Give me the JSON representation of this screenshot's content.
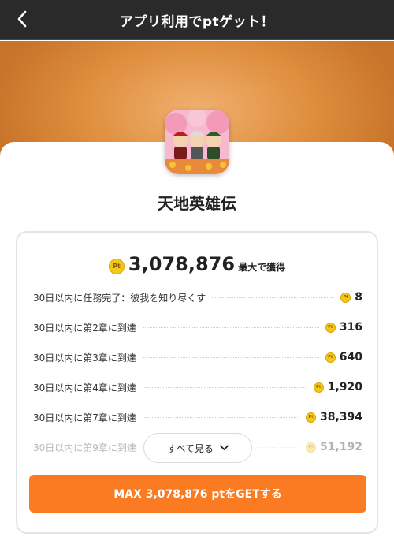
{
  "header": {
    "title": "アプリ利用でptゲット！",
    "back_icon": "chevron-left-icon"
  },
  "colors": {
    "header_bg": "#2a2a2a",
    "hero": "#df8f3e",
    "accent": "#fb7b23",
    "coin": "#f3c81c"
  },
  "app": {
    "name": "天地英雄伝"
  },
  "coin_label": "Pt",
  "summary": {
    "total": "3,078,876",
    "suffix": "最大で獲得"
  },
  "tasks": [
    {
      "label": "30日以内に任務完了：彼我を知り尽くす",
      "points": "8"
    },
    {
      "label": "30日以内に第2章に到達",
      "points": "316"
    },
    {
      "label": "30日以内に第3章に到達",
      "points": "640"
    },
    {
      "label": "30日以内に第4章に到達",
      "points": "1,920"
    },
    {
      "label": "30日以内に第7章に到達",
      "points": "38,394"
    },
    {
      "label": "30日以内に第9章に到達",
      "points": "51,192"
    }
  ],
  "see_all": {
    "label": "すべて見る",
    "icon": "chevron-down-icon"
  },
  "cta": {
    "label": "MAX 3,078,876 ptをGETする"
  }
}
